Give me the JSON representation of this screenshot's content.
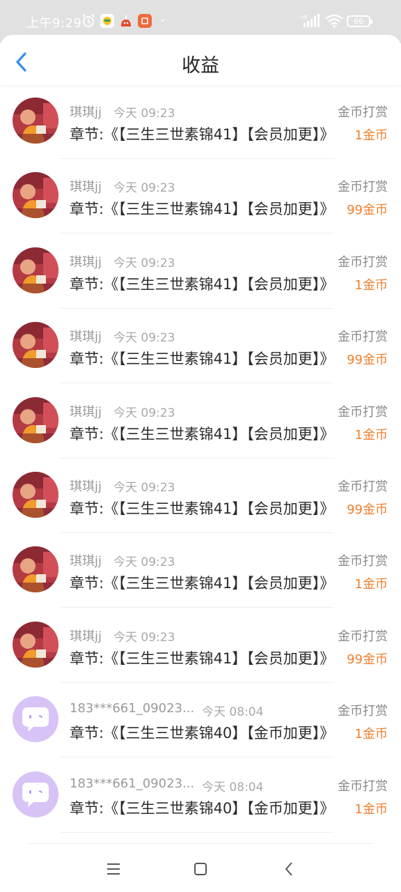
{
  "status_bar": {
    "time": "上午9:29",
    "battery": "66",
    "icons": [
      "alarm-icon",
      "app-icon-yellow",
      "app-icon-red",
      "app-icon-orange",
      "signal-icon",
      "wifi-icon",
      "battery-icon"
    ]
  },
  "header": {
    "title": "收益",
    "back_icon": "chevron-left-icon",
    "accent_color": "#2e8ff0"
  },
  "colors": {
    "amount": "#f07f2c",
    "avatar_default_bg": "#d7c3f6"
  },
  "records": [
    {
      "name": "琪琪jj",
      "time": "今天 09:23",
      "type": "金币打赏",
      "chapter": "章节:《【三生三世素锦41】【会员加更】》",
      "amount": "1金币",
      "avatar": "photo-avatar"
    },
    {
      "name": "琪琪jj",
      "time": "今天 09:23",
      "type": "金币打赏",
      "chapter": "章节:《【三生三世素锦41】【会员加更】》",
      "amount": "99金币",
      "avatar": "photo-avatar"
    },
    {
      "name": "琪琪jj",
      "time": "今天 09:23",
      "type": "金币打赏",
      "chapter": "章节:《【三生三世素锦41】【会员加更】》",
      "amount": "1金币",
      "avatar": "photo-avatar"
    },
    {
      "name": "琪琪jj",
      "time": "今天 09:23",
      "type": "金币打赏",
      "chapter": "章节:《【三生三世素锦41】【会员加更】》",
      "amount": "99金币",
      "avatar": "photo-avatar"
    },
    {
      "name": "琪琪jj",
      "time": "今天 09:23",
      "type": "金币打赏",
      "chapter": "章节:《【三生三世素锦41】【会员加更】》",
      "amount": "1金币",
      "avatar": "photo-avatar"
    },
    {
      "name": "琪琪jj",
      "time": "今天 09:23",
      "type": "金币打赏",
      "chapter": "章节:《【三生三世素锦41】【会员加更】》",
      "amount": "99金币",
      "avatar": "photo-avatar"
    },
    {
      "name": "琪琪jj",
      "time": "今天 09:23",
      "type": "金币打赏",
      "chapter": "章节:《【三生三世素锦41】【会员加更】》",
      "amount": "1金币",
      "avatar": "photo-avatar"
    },
    {
      "name": "琪琪jj",
      "time": "今天 09:23",
      "type": "金币打赏",
      "chapter": "章节:《【三生三世素锦41】【会员加更】》",
      "amount": "99金币",
      "avatar": "photo-avatar"
    },
    {
      "name": "183***661_09023...",
      "time": "今天 08:04",
      "type": "金币打赏",
      "chapter": "章节:《【三生三世素锦40】【金币加更】》",
      "amount": "1金币",
      "avatar": "default-chat-avatar"
    },
    {
      "name": "183***661_09023...",
      "time": "今天 08:04",
      "type": "金币打赏",
      "chapter": "章节:《【三生三世素锦40】【金币加更】》",
      "amount": "1金币",
      "avatar": "default-chat-avatar"
    }
  ],
  "nav_bar": {
    "icons": [
      "menu-icon",
      "home-icon",
      "back-icon"
    ]
  }
}
